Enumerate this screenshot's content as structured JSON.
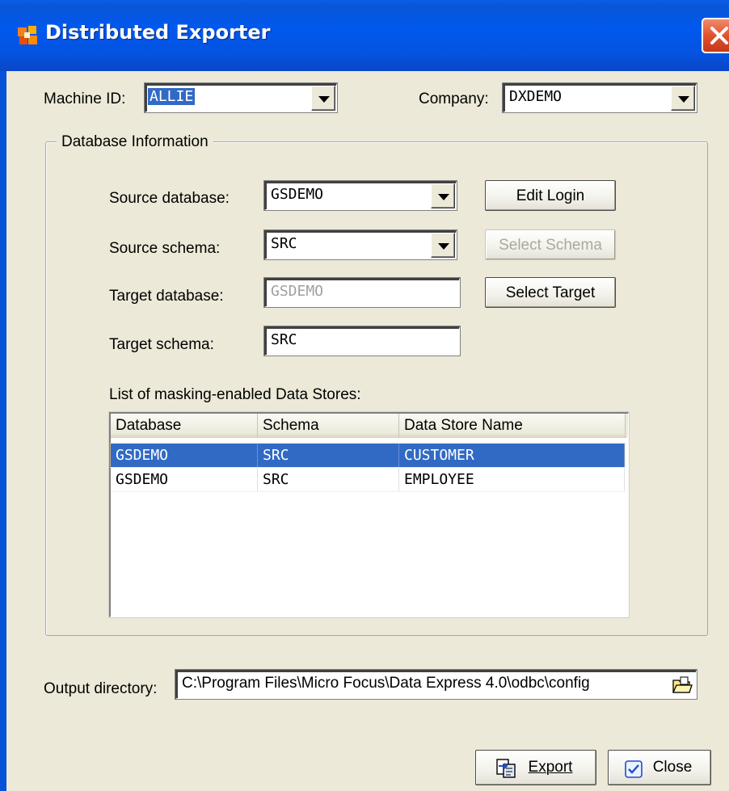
{
  "window": {
    "title": "Distributed Exporter"
  },
  "machine": {
    "label": "Machine ID:",
    "value": "ALLIE"
  },
  "company": {
    "label": "Company:",
    "value": "DXDEMO"
  },
  "database_info": {
    "title": "Database Information",
    "source_database": {
      "label": "Source database:",
      "value": "GSDEMO"
    },
    "source_schema": {
      "label": "Source schema:",
      "value": "SRC"
    },
    "target_database": {
      "label": "Target database:",
      "value": "GSDEMO"
    },
    "target_schema": {
      "label": "Target schema:",
      "value": "SRC"
    },
    "buttons": {
      "edit_login": "Edit Login",
      "select_schema": "Select Schema",
      "select_target": "Select Target"
    },
    "list_label": "List of masking-enabled Data Stores:",
    "columns": [
      "Database",
      "Schema",
      "Data Store Name"
    ],
    "rows": [
      [
        "GSDEMO",
        "SRC",
        "CUSTOMER"
      ],
      [
        "GSDEMO",
        "SRC",
        "EMPLOYEE"
      ]
    ]
  },
  "output": {
    "label": "Output directory:",
    "value": "C:\\Program Files\\Micro Focus\\Data Express 4.0\\odbc\\config"
  },
  "footer": {
    "export": "Export",
    "close": "Close"
  },
  "colors": {
    "titlebar": "#0058ee",
    "selection": "#316ac5",
    "close": "#e2512c"
  }
}
